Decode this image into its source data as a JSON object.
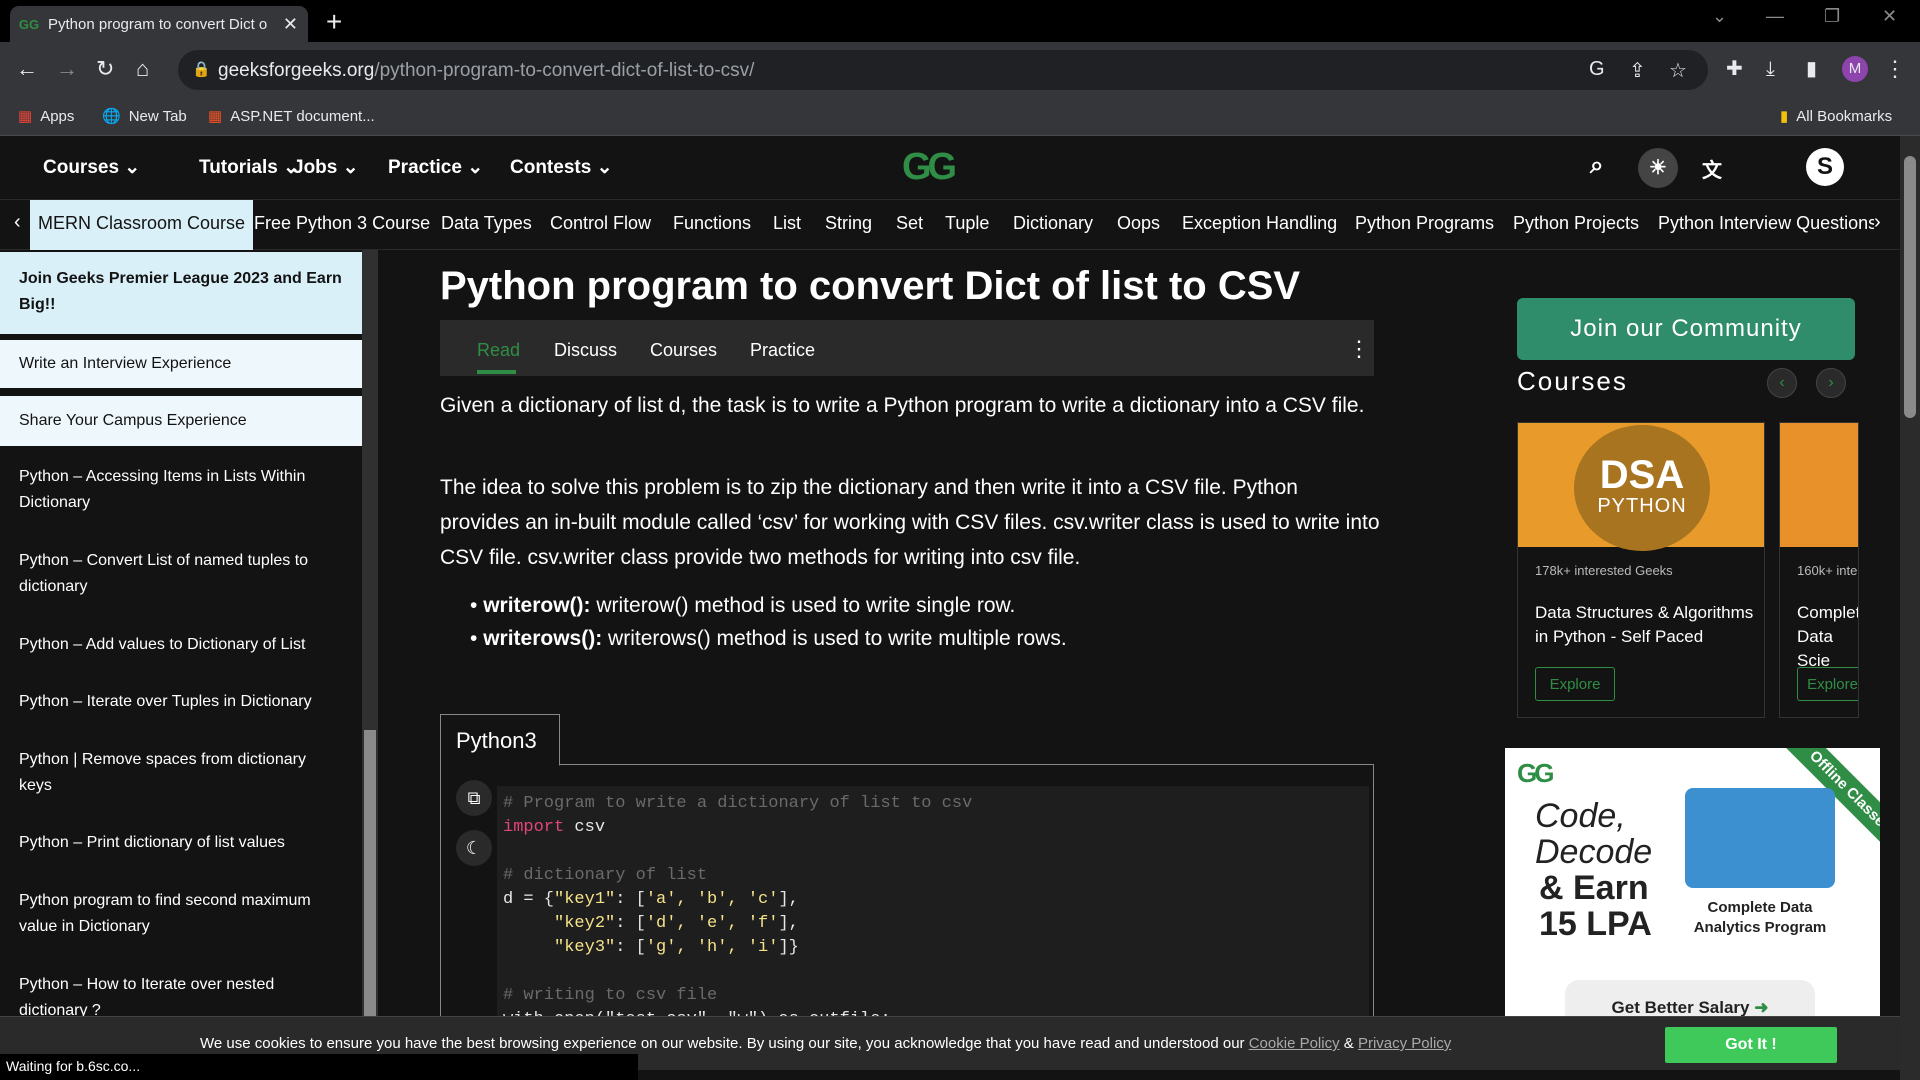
{
  "browser": {
    "tab_title": "Python program to convert Dict o",
    "url_domain": "geeksforgeeks.org",
    "url_path": "/python-program-to-convert-dict-of-list-to-csv/",
    "bookmarks": [
      "Apps",
      "New Tab",
      "ASP.NET document..."
    ],
    "all_bookmarks": "All Bookmarks",
    "profile_initial": "M"
  },
  "site": {
    "logo_text": "GG",
    "nav": [
      "Courses",
      "Tutorials",
      "Jobs",
      "Practice",
      "Contests"
    ],
    "user_initial": "S",
    "subnav": [
      "MERN Classroom Course",
      "Free Python 3 Course",
      "Data Types",
      "Control Flow",
      "Functions",
      "List",
      "String",
      "Set",
      "Tuple",
      "Dictionary",
      "Oops",
      "Exception Handling",
      "Python Programs",
      "Python Projects",
      "Python Interview Questions"
    ]
  },
  "sidebar": {
    "items": [
      "Join Geeks Premier League 2023 and Earn Big!!",
      "Write an Interview Experience",
      "Share Your Campus Experience",
      "Python – Accessing Items in Lists Within Dictionary",
      "Python – Convert List of named tuples to dictionary",
      "Python – Add values to Dictionary of List",
      "Python – Iterate over Tuples in Dictionary",
      "Python | Remove spaces from dictionary keys",
      "Python – Print dictionary of list values",
      "Python program to find second maximum value in Dictionary",
      "Python – How to Iterate over nested dictionary ?"
    ]
  },
  "article": {
    "title": "Python program to convert Dict of list to CSV",
    "tabs": [
      "Read",
      "Discuss",
      "Courses",
      "Practice"
    ],
    "para1": "Given a dictionary of list d, the task is to write a Python program to write a dictionary into a CSV file.",
    "para2": "The idea to solve this problem is to zip the dictionary and then write it into a CSV file. Python provides an in-built module called ‘csv’ for working with CSV files. csv.writer class is used to write into CSV file. csv.writer class provide two methods for writing into csv file.",
    "bullets": [
      {
        "term": "writerow():",
        "text": " writerow() method is used to write single row."
      },
      {
        "term": "writerows():",
        "text": " writerows() method is used to write multiple rows."
      }
    ],
    "code_tab": "Python3",
    "code": {
      "c1": "# Program to write a dictionary of list to csv",
      "kw_import": "import",
      "mod": " csv",
      "c2": "# dictionary of list",
      "d_line1_a": "d = {",
      "d_line1_k": "\"key1\"",
      "d_line1_b": ": [",
      "d_line1_v": "'a', 'b', 'c'",
      "d_line1_c": "],",
      "d_line2_k": "\"key2\"",
      "d_line2_v": "'d', 'e', 'f'",
      "d_line3_k": "\"key3\"",
      "d_line3_v": "'g', 'h', 'i'",
      "c3": "# writing to csv file",
      "last": "with open(\"test.csv\", \"w\") as outfile:"
    }
  },
  "right": {
    "community": "Join our Community",
    "courses_heading": "Courses",
    "cards": [
      {
        "badge1": "DSA",
        "badge2": "PYTHON",
        "meta": "178k+ interested Geeks",
        "name": "Data Structures & Algorithms in Python - Self Paced",
        "btn": "Explore"
      },
      {
        "meta": "160k+ inte",
        "name": "Complet Data Scie",
        "btn": "Explore"
      }
    ],
    "ad": {
      "line1": "Code,",
      "line2": "Decode",
      "line3": "& Earn",
      "line4": "15 LPA",
      "ribbon": "Offline Classes",
      "program": "Complete Data Analytics Program",
      "salary": "Get Better Salary"
    }
  },
  "cookie": {
    "msg": "We use cookies to ensure you have the best browsing experience on our website. By using our site, you acknowledge that you have read and understood our ",
    "cookie_policy": "Cookie Policy",
    "amp": " & ",
    "privacy_policy": "Privacy Policy",
    "button": "Got It !"
  },
  "status": "Waiting for b.6sc.co..."
}
